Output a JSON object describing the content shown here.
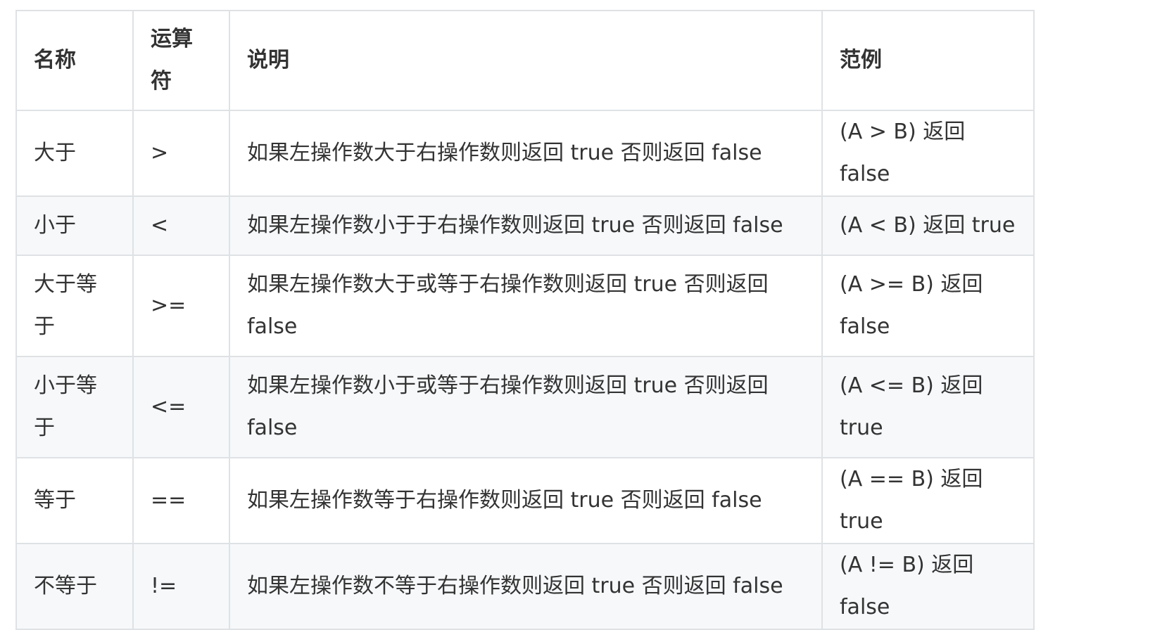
{
  "table": {
    "headers": {
      "name": "名称",
      "operator": "运算符",
      "description": "说明",
      "example": "范例"
    },
    "rows": [
      {
        "name": "大于",
        "operator": ">",
        "description": "如果左操作数大于右操作数则返回 true 否则返回 false",
        "example": "(A > B) 返回 false"
      },
      {
        "name": "小于",
        "operator": "<",
        "description": "如果左操作数小于于右操作数则返回 true 否则返回 false",
        "example": "(A < B) 返回 true"
      },
      {
        "name": "大于等于",
        "operator": ">=",
        "description": "如果左操作数大于或等于右操作数则返回 true 否则返回 false",
        "example": "(A >= B) 返回 false"
      },
      {
        "name": "小于等于",
        "operator": "<=",
        "description": "如果左操作数小于或等于右操作数则返回 true 否则返回 false",
        "example": "(A <= B) 返回 true"
      },
      {
        "name": "等于",
        "operator": "==",
        "description": "如果左操作数等于右操作数则返回 true 否则返回 false",
        "example": "(A == B) 返回 true"
      },
      {
        "name": "不等于",
        "operator": "!=",
        "description": "如果左操作数不等于右操作数则返回 true 否则返回 false",
        "example": "(A != B) 返回 false"
      }
    ]
  },
  "colors": {
    "border": "#dfe2e5",
    "stripe": "#f6f8fa",
    "text": "#333333"
  }
}
